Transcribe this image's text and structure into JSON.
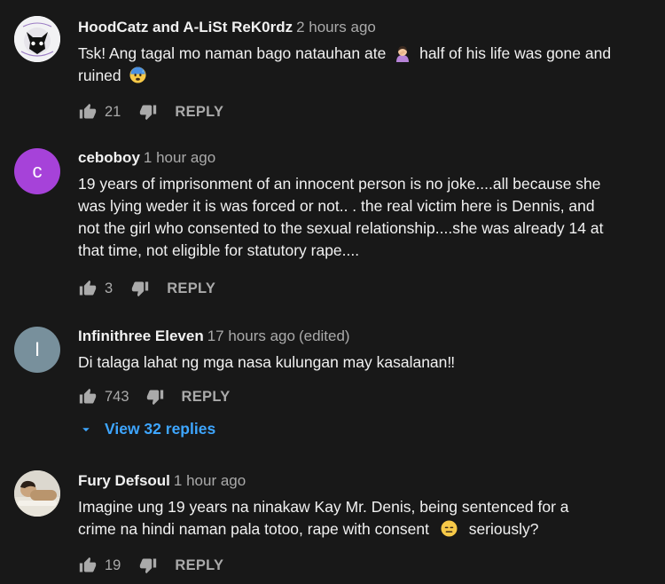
{
  "comments": [
    {
      "author": "HoodCatz and A-LiSt ReK0rdz",
      "time": "2 hours ago",
      "text_before_emoji": "Tsk! Ang tagal mo naman bago natauhan ate",
      "text_after_emoji": "half of his life was gone and ruined",
      "emoji_1": "person-facepalming-emoji",
      "emoji_2": "anxious-face-emoji",
      "likes": "21",
      "reply_label": "REPLY",
      "avatar": "cat-logo-avatar"
    },
    {
      "author": "ceboboy",
      "time": "1 hour ago",
      "text": "19 years of imprisonment of an innocent person is no joke....all because she was lying weder it is was forced or not.. . the real victim here is Dennis, and not the girl who consented to the sexual relationship....she was already 14 at that time,  not eligible for statutory  rape....",
      "likes": "3",
      "reply_label": "REPLY",
      "avatar_letter": "c",
      "avatar_color": "#a642d9"
    },
    {
      "author": "Infinithree Eleven",
      "time": "17 hours ago",
      "edited": "(edited)",
      "text": "Di talaga lahat ng mga nasa kulungan may kasalanan‼",
      "likes": "743",
      "reply_label": "REPLY",
      "avatar_letter": "I",
      "avatar_color": "#78909c",
      "view_replies": "View 32 replies"
    },
    {
      "author": "Fury Defsoul",
      "time": "1 hour ago",
      "text_before_emoji": "Imagine ung 19 years na ninakaw Kay Mr. Denis, being sentenced for a crime na hindi naman pala totoo, rape with consent",
      "text_after_emoji": "seriously?",
      "emoji": "expressionless-face-emoji",
      "likes": "19",
      "reply_label": "REPLY",
      "avatar": "photo-avatar"
    }
  ],
  "colors": {
    "background": "#181818",
    "text": "#f1f1f1",
    "secondary": "#aaaaaa",
    "link": "#3ea6ff"
  }
}
